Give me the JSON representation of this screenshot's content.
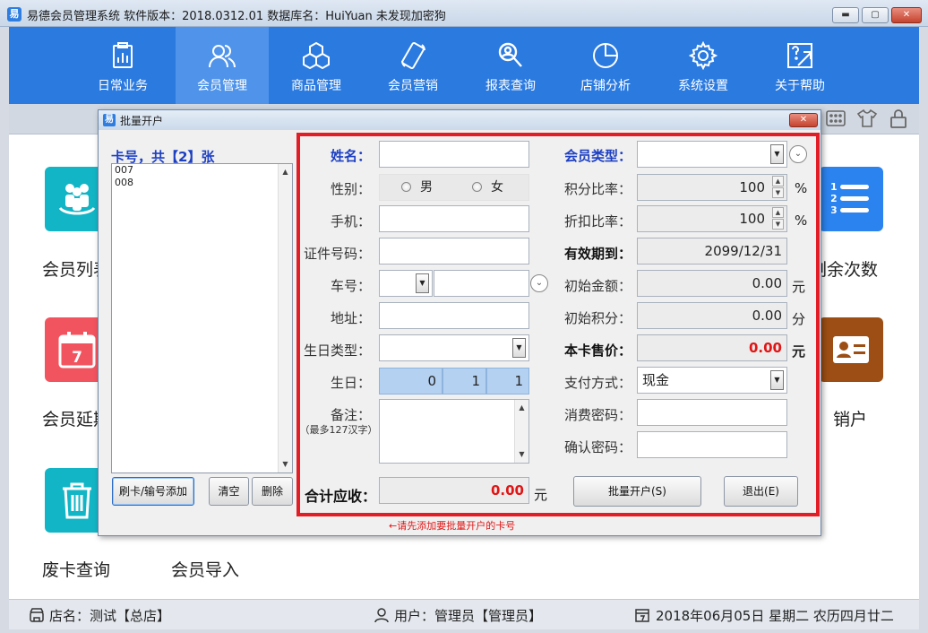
{
  "window": {
    "title": "易德会员管理系统    软件版本：2018.0312.01     数据库名：HuiYuan    未发现加密狗",
    "minimize_label": "▬",
    "maximize_label": "▢",
    "close_label": "✕"
  },
  "nav": {
    "items": [
      {
        "label": "日常业务",
        "icon": "clipboard-chart-icon"
      },
      {
        "label": "会员管理",
        "icon": "users-icon"
      },
      {
        "label": "商品管理",
        "icon": "cubes-icon"
      },
      {
        "label": "会员营销",
        "icon": "phone-tag-icon"
      },
      {
        "label": "报表查询",
        "icon": "magnifier-person-icon"
      },
      {
        "label": "店铺分析",
        "icon": "pie-chart-icon"
      },
      {
        "label": "系统设置",
        "icon": "gear-icon"
      },
      {
        "label": "关于帮助",
        "icon": "help-arrow-icon"
      }
    ],
    "active_index": 1
  },
  "toolbar_icons": [
    "calculator-icon",
    "shirt-icon",
    "lock-icon"
  ],
  "tiles": {
    "member_list": "会员列表",
    "remaining_times": "剩余次数",
    "member_extend": "会员延期",
    "cancel_card": "销户",
    "abandoned_card": "废卡查询",
    "member_import": "会员导入",
    "calendar_day": "7",
    "list_numbers": [
      "1",
      "2",
      "3"
    ],
    "colors": {
      "teal": "#12b5c5",
      "red": "#f2545f",
      "blue": "#2b83f0",
      "brown": "#9c4e14"
    }
  },
  "status": {
    "store": "店名：测试【总店】",
    "user": "用户：管理员【管理员】",
    "date": "2018年06月05日 星期二 农历四月廿二"
  },
  "dialog": {
    "title": "批量开户",
    "close_label": "✕",
    "card_count": "卡号，共【2】张",
    "cards": [
      "007",
      "008"
    ],
    "buttons": {
      "swipe_add": "刷卡/输号添加",
      "clear": "清空",
      "delete": "删除",
      "open": "批量开户(S)",
      "exit": "退出(E)"
    },
    "form": {
      "name_label": "姓名：",
      "gender_label": "性别：",
      "gender_male": "男",
      "gender_female": "女",
      "phone_label": "手机：",
      "id_label": "证件号码：",
      "car_label": "车号：",
      "address_label": "地址：",
      "birthday_type_label": "生日类型：",
      "birthday_label": "生日：",
      "birthday_year": "0",
      "birthday_month": "1",
      "birthday_day": "1",
      "remark_label": "备注：",
      "remark_hint": "（最多127汉字）",
      "total_label": "合计应收：",
      "total_value": "0.00",
      "total_unit": "元",
      "member_type_label": "会员类型：",
      "points_ratio_label": "积分比率：",
      "points_ratio_value": "100",
      "discount_ratio_label": "折扣比率：",
      "discount_ratio_value": "100",
      "percent": "%",
      "valid_until_label": "有效期到：",
      "valid_until_value": "2099/12/31",
      "initial_amount_label": "初始金额：",
      "initial_amount_value": "0.00",
      "yuan": "元",
      "initial_points_label": "初始积分：",
      "initial_points_value": "0.00",
      "fen": "分",
      "card_price_label": "本卡售价：",
      "card_price_value": "0.00",
      "payment_label": "支付方式：",
      "payment_value": "现金",
      "password_label": "消费密码：",
      "confirm_password_label": "确认密码："
    },
    "hint": "←请先添加要批量开户的卡号"
  }
}
